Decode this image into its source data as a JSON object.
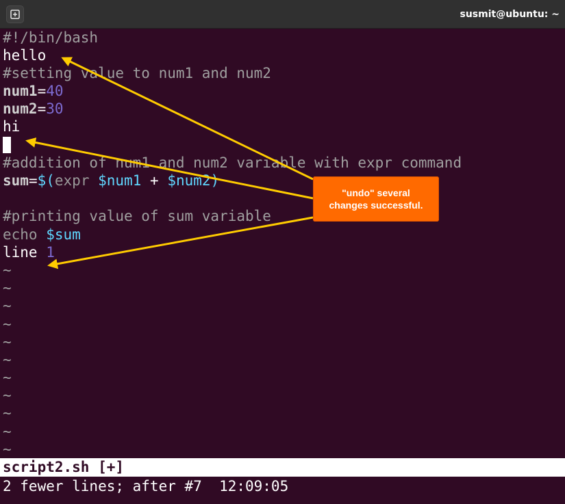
{
  "window": {
    "title": "susmit@ubuntu: ~",
    "newtab_icon": "new-tab-icon"
  },
  "editor": {
    "shebang": "#!/bin/bash",
    "hello": "hello",
    "comment1": "#setting value to num1 and num2",
    "num1_name": "num1",
    "num1_eq": "=",
    "num1_val": "40",
    "num2_name": "num2",
    "num2_eq": "=",
    "num2_val": "30",
    "hi": "hi",
    "comment2": "#addition of num1 and num2 variable with expr command",
    "sum_name": "sum",
    "sum_eq": "=",
    "sum_open": "$(",
    "sum_expr": "expr",
    "sum_var1": "$num1",
    "sum_plus": "+",
    "sum_var2": "$num2",
    "sum_close": ")",
    "comment3": "#printing value of sum variable",
    "echo": "echo",
    "echo_var": "$sum",
    "line_word": "line",
    "line_num": "1",
    "tilde": "~"
  },
  "statusbar": {
    "filename": "script2.sh [+]"
  },
  "cmdline": {
    "message": "2 fewer lines; after #7  12:09:05"
  },
  "callout": {
    "text": "\"undo\" several changes successful."
  },
  "colors": {
    "background": "#300a24",
    "callout": "#ff6a00",
    "arrow": "#ffcc00"
  }
}
